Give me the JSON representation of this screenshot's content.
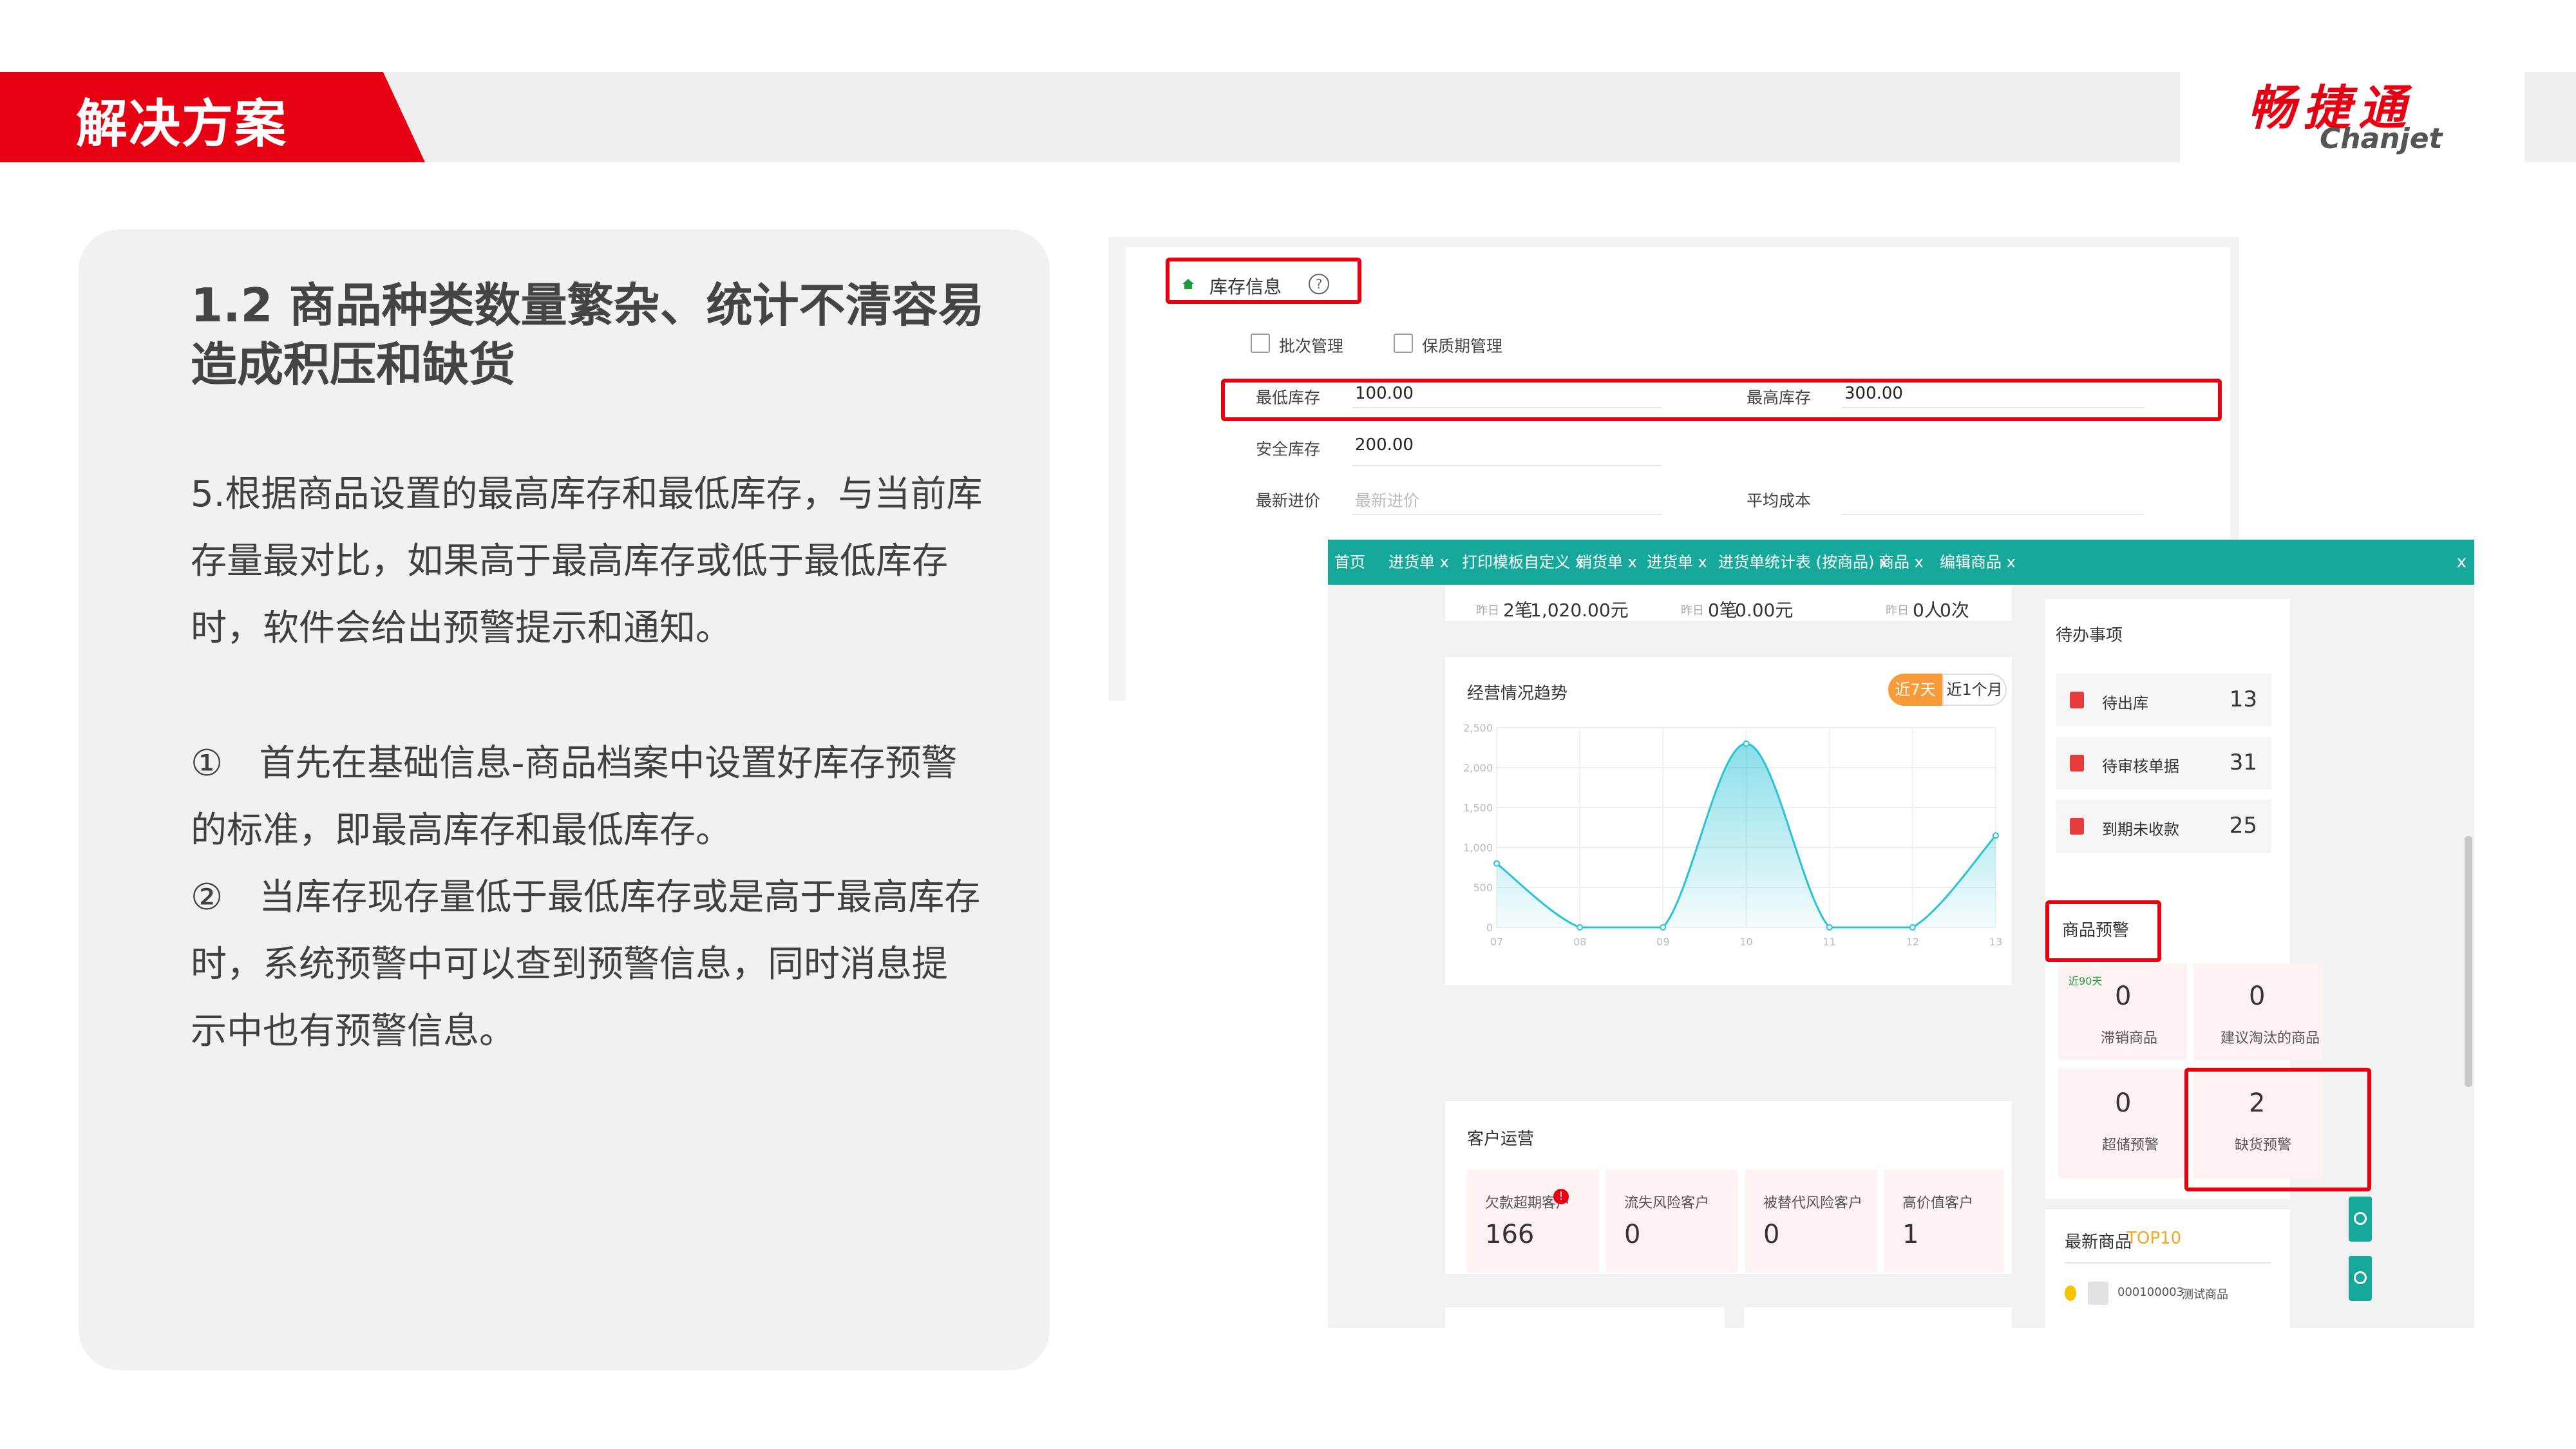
{
  "header": {
    "section_title": "解决方案",
    "logo_cn": "畅捷通",
    "logo_en": "Chanjet",
    "accent_color": "#e60012"
  },
  "card": {
    "title": "1.2 商品种类数量繁杂、统计不清容易造成积压和缺货",
    "para1": "5.根据商品设置的最高库存和最低库存，与当前库存量最对比，如果高于最高库存或低于最低库存时，软件会给出预警提示和通知。",
    "point1": "①　首先在基础信息-商品档案中设置好库存预警的标准，即最高库存和最低库存。",
    "point2": "②　当库存现存量低于最低库存或是高于最高库存时，系统预警中可以查到预警信息，同时消息提示中也有预警信息。"
  },
  "inventory_form": {
    "section_label": "库存信息",
    "batch_label": "批次管理",
    "shelf_label": "保质期管理",
    "min_label": "最低库存",
    "min_value": "100.00",
    "max_label": "最高库存",
    "max_value": "300.00",
    "safe_label": "安全库存",
    "safe_value": "200.00",
    "latest_price_label": "最新进价",
    "latest_price_placeholder": "最新进价",
    "avg_cost_label": "平均成本"
  },
  "dashboard": {
    "tabs": [
      "首页",
      "进货单 x",
      "打印模板自定义 x",
      "销货单 x",
      "进货单 x",
      "进货单统计表 (按商品) x",
      "商品 x",
      "编辑商品 x"
    ],
    "tab_close": "x",
    "yesterday": [
      {
        "label": "昨日",
        "count": "2笔",
        "amount": "1,020.00元"
      },
      {
        "label": "昨日",
        "count": "0笔",
        "amount": "0.00元"
      },
      {
        "label": "昨日",
        "count": "0人",
        "amount": "0次"
      }
    ],
    "trend": {
      "title": "经营情况趋势",
      "btn_7days": "近7天",
      "btn_month": "近1个月"
    },
    "customer": {
      "title": "客户运营",
      "stats": [
        {
          "label": "欠款超期客户",
          "value": "166",
          "badge": "!"
        },
        {
          "label": "流失风险客户",
          "value": "0"
        },
        {
          "label": "被替代风险客户",
          "value": "0"
        },
        {
          "label": "高价值客户",
          "value": "1"
        }
      ]
    },
    "todo": {
      "title": "待办事项",
      "items": [
        {
          "label": "待出库",
          "value": "13"
        },
        {
          "label": "待审核单据",
          "value": "31"
        },
        {
          "label": "到期未收款",
          "value": "25"
        }
      ]
    },
    "warning": {
      "title": "商品预警",
      "tag": "近90天",
      "cards": [
        {
          "value": "0",
          "label": "滞销商品"
        },
        {
          "value": "0",
          "label": "建议淘汰的商品"
        },
        {
          "value": "0",
          "label": "超储预警"
        },
        {
          "value": "2",
          "label": "缺货预警"
        }
      ]
    },
    "newest": {
      "title": "最新商品",
      "title_accent": "TOP10",
      "item_code": "000100003",
      "item_name": "测试商品"
    },
    "chart_color": "#29c3d6",
    "teal": "#17a89c"
  },
  "chart_data": {
    "type": "area",
    "title": "",
    "x": [
      "07",
      "08",
      "09",
      "10",
      "11",
      "12",
      "13"
    ],
    "series": [
      {
        "values": [
          800,
          0,
          0,
          2300,
          0,
          0,
          1150
        ]
      }
    ],
    "yticks": [
      "0",
      "500",
      "1,000",
      "1,500",
      "2,000",
      "2,500"
    ],
    "ylim": [
      0,
      2500
    ],
    "grid": true
  }
}
